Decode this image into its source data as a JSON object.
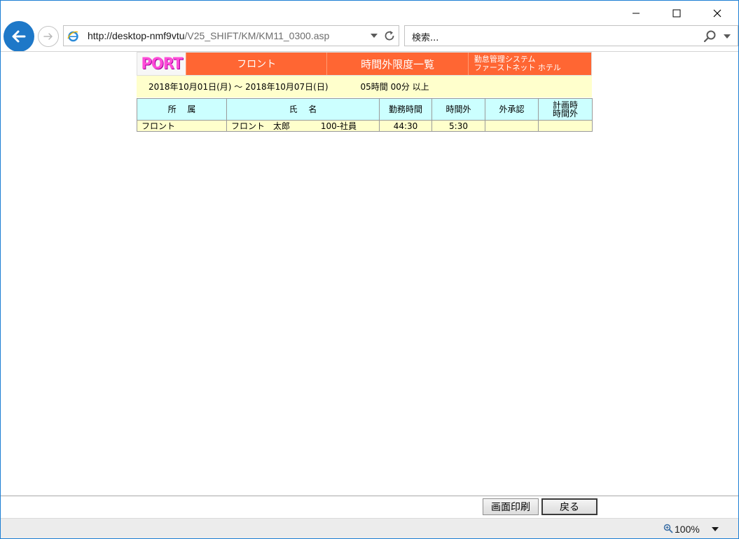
{
  "browser": {
    "url_host": "http://desktop-nmf9vtu",
    "url_path": "/V25_SHIFT/KM/KM11_0300.asp",
    "search_placeholder": "検索...",
    "zoom": "100%"
  },
  "header": {
    "logo_text": "PORT",
    "department": "フロント",
    "page_title": "時間外限度一覧",
    "system_line1": "勤怠管理システム",
    "system_line2": "ファーストネット ホテル"
  },
  "condition": {
    "period": "2018年10月01日(月) ～ 2018年10月07日(日)",
    "limit": "05時間 00分 以上"
  },
  "table": {
    "columns": {
      "dept": "所　 属",
      "name": "氏　 名",
      "work_hours": "勤務時間",
      "overtime": "時間外",
      "outside_approval": "外承認",
      "planned_line1": "計画時",
      "planned_line2": "時間外"
    },
    "rows": [
      {
        "dept": "フロント",
        "name": "フロント　太郎",
        "code": "100-社員",
        "work_hours": "44:30",
        "overtime": "5:30",
        "outside_approval": "",
        "planned_overtime": ""
      }
    ]
  },
  "toolbar": {
    "print_label": "画面印刷",
    "back_label": "戻る"
  },
  "colors": {
    "header_bg": "#ff6633",
    "condition_bg": "#ffffcc",
    "column_header_bg": "#ccffff",
    "logo_text": "#ff4cd8",
    "browser_back": "#1e78c8"
  }
}
